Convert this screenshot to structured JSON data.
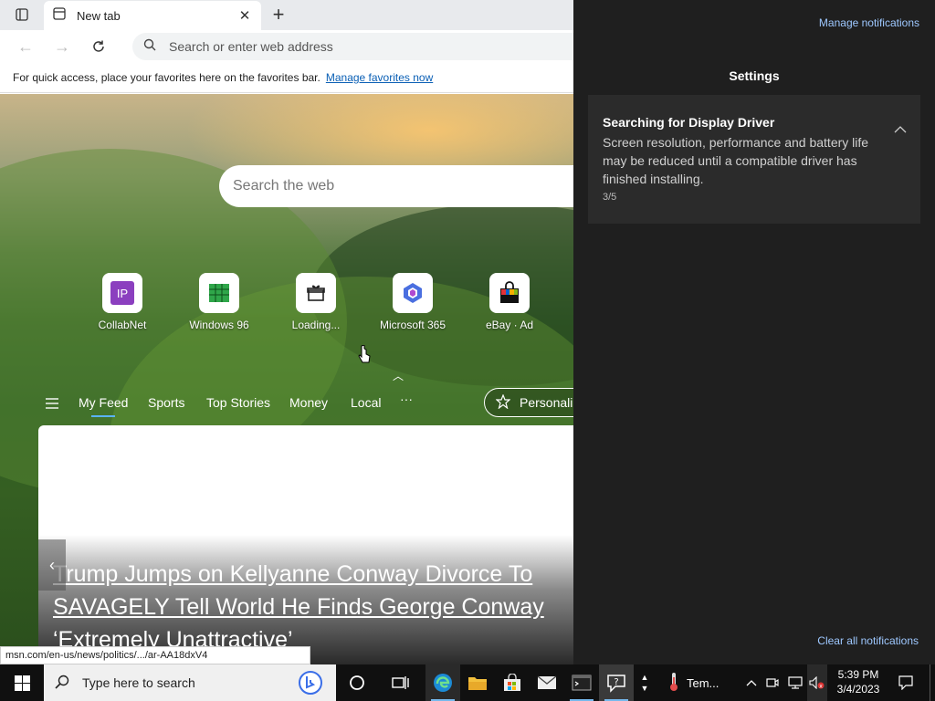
{
  "browser": {
    "tab": {
      "title": "New tab",
      "close_icon": "close-icon"
    },
    "address_placeholder": "Search or enter web address",
    "favorites_bar": {
      "text": "For quick access, place your favorites here on the favorites bar.",
      "link": "Manage favorites now"
    },
    "ntp": {
      "search_placeholder": "Search the web",
      "quick_links": [
        {
          "label": "CollabNet"
        },
        {
          "label": "Windows 96"
        },
        {
          "label": "Loading..."
        },
        {
          "label": "Microsoft 365"
        },
        {
          "label": "eBay · Ad"
        }
      ],
      "feed_nav": [
        "My Feed",
        "Sports",
        "Top Stories",
        "Money",
        "Local",
        "···"
      ],
      "personalize": "Personali",
      "headline": "Trump Jumps on Kellyanne Conway Divorce To SAVAGELY Tell World He Finds George Conway ‘Extremely Unattractive’"
    },
    "status_url": "msn.com/en-us/news/politics/.../ar-AA18dxV4"
  },
  "panel": {
    "manage": "Manage notifications",
    "group_title": "Settings",
    "notification": {
      "title": "Searching for Display Driver",
      "body": "Screen resolution, performance and battery life may be reduced until a compatible driver has finished installing.",
      "count": "3/5"
    },
    "clear_all": "Clear all notifications"
  },
  "taskbar": {
    "search_placeholder": "Type here to search",
    "weather_label": "Tem...",
    "time": "5:39 PM",
    "date": "3/4/2023"
  },
  "colors": {
    "accent": "#0a5fb5",
    "panel_bg": "#1f1f1f",
    "taskbar_bg": "#101010",
    "panel_link": "#9ec8ff"
  }
}
